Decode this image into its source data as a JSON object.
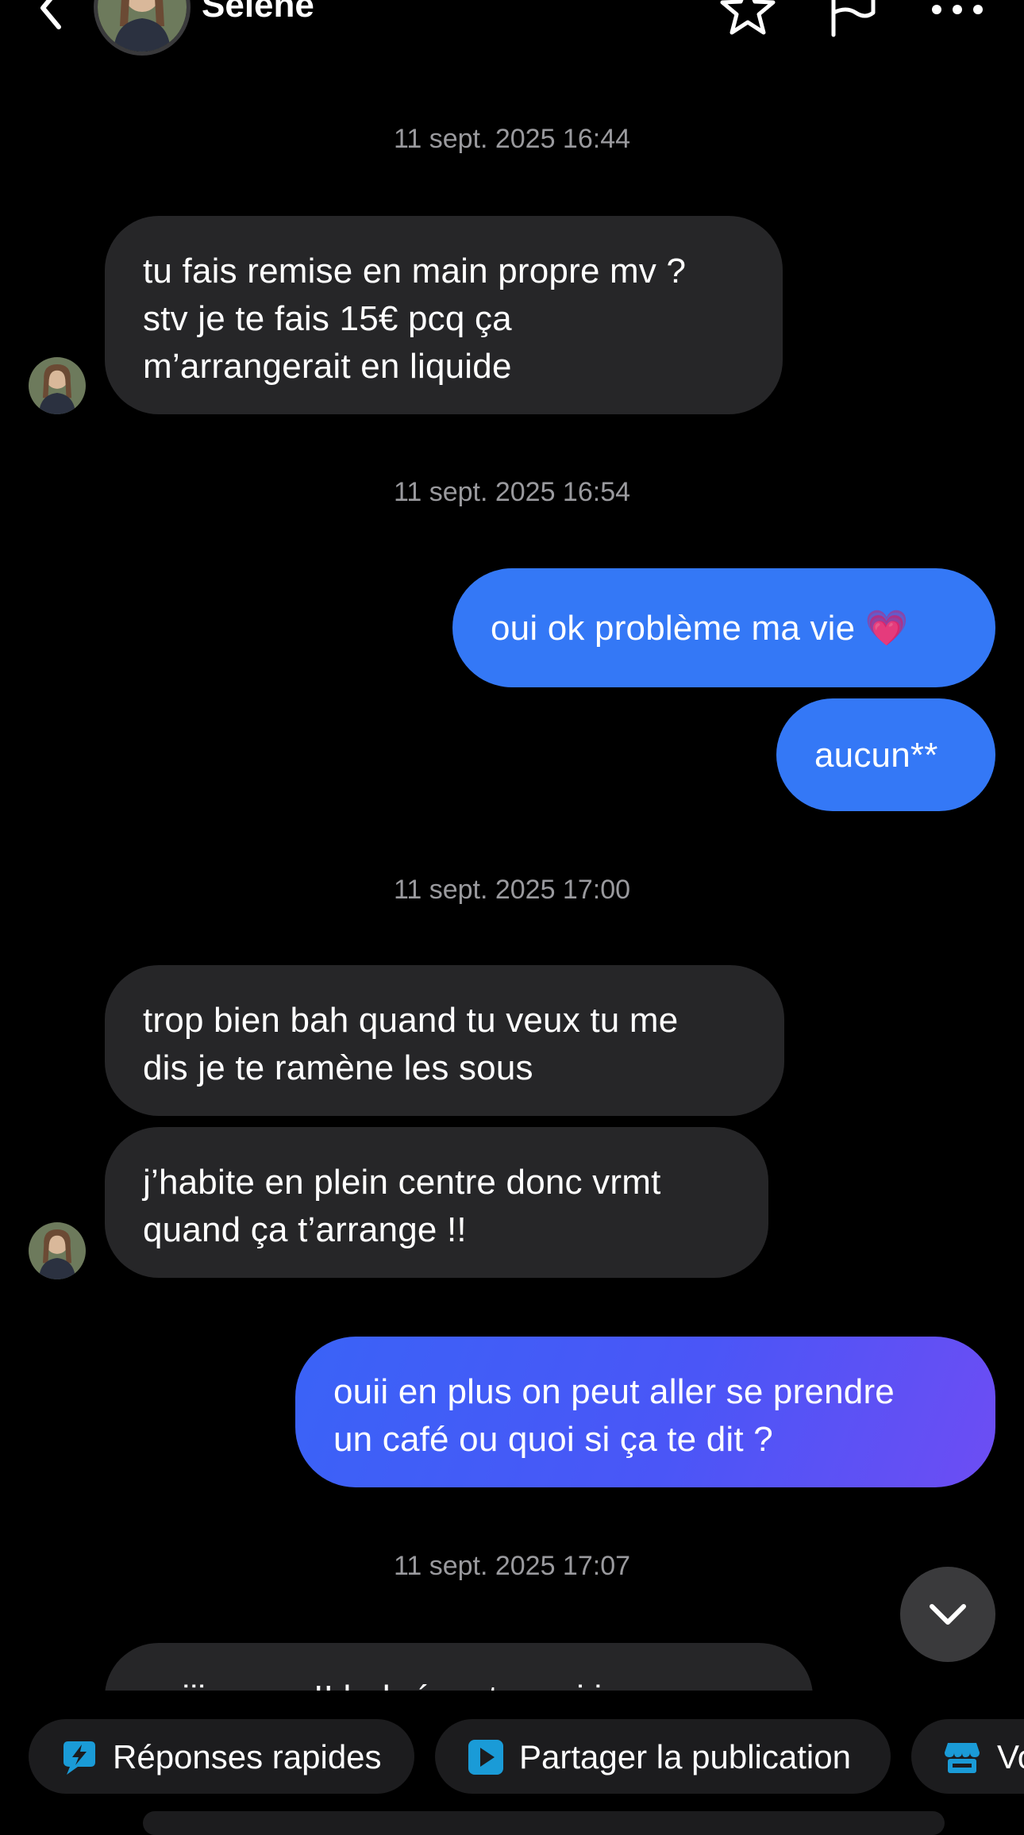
{
  "header": {
    "contact_name": "Sélène",
    "icons": [
      "chevron-left-icon",
      "star-icon",
      "flag-icon",
      "more-icon"
    ]
  },
  "messages": [
    {
      "type": "timestamp",
      "text": "11 sept. 2025 16:44"
    },
    {
      "type": "incoming",
      "text": "tu fais remise en main propre mv ?\nstv je te fais 15€ pcq ça\nm’arrangerait en liquide"
    },
    {
      "type": "timestamp",
      "text": "11 sept. 2025 16:54"
    },
    {
      "type": "outgoing",
      "text": "oui ok problème ma vie 💗"
    },
    {
      "type": "outgoing",
      "text": "aucun**"
    },
    {
      "type": "timestamp",
      "text": "11 sept. 2025 17:00"
    },
    {
      "type": "incoming",
      "text": "trop bien bah quand tu veux tu me\ndis je te ramène les sous"
    },
    {
      "type": "incoming",
      "text": "j’habite en plein centre donc vrmt\nquand ça t’arrange !!"
    },
    {
      "type": "outgoing",
      "text": "ouii en plus on peut aller se prendre\nun café ou quoi si ça te dit ?"
    },
    {
      "type": "timestamp",
      "text": "11 sept. 2025 17:07"
    },
    {
      "type": "incoming",
      "text": "ouiii grave !! bah écoute moi je peux"
    }
  ],
  "quick_actions": [
    {
      "label": "Réponses rapides",
      "icon": "lightning-icon"
    },
    {
      "label": "Partager la publication",
      "icon": "play-icon"
    },
    {
      "label": "Vo",
      "icon": "shop-icon"
    }
  ],
  "colors": {
    "background": "#000000",
    "incoming_bubble": "#262628",
    "outgoing_bubble": "#3478f6",
    "timestamp": "#9a9a9e",
    "chip": "#1c1c1e",
    "accent": "#1a9bd7"
  }
}
